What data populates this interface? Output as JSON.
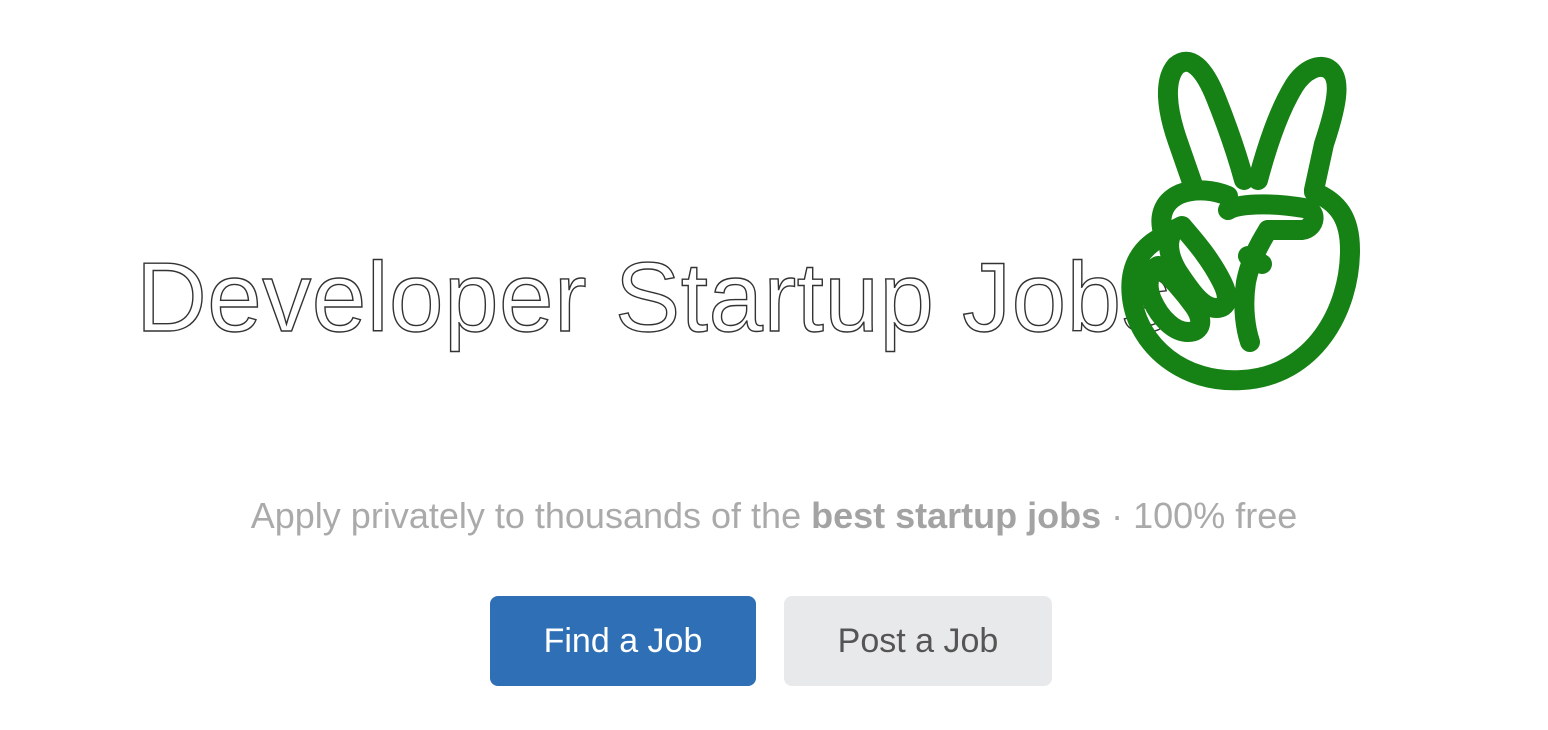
{
  "hero": {
    "title": "Developer Startup Jobs",
    "logo_icon": "angellist-peace-hand-icon",
    "logo_color": "#168114",
    "tagline": {
      "part1": "Apply privately to thousands of the ",
      "bold": "best startup jobs",
      "part2": " · 100% free"
    }
  },
  "actions": {
    "find_label": "Find a Job",
    "post_label": "Post a Job",
    "find_color": "#2f6fb6",
    "post_color": "#e8e9eb"
  }
}
